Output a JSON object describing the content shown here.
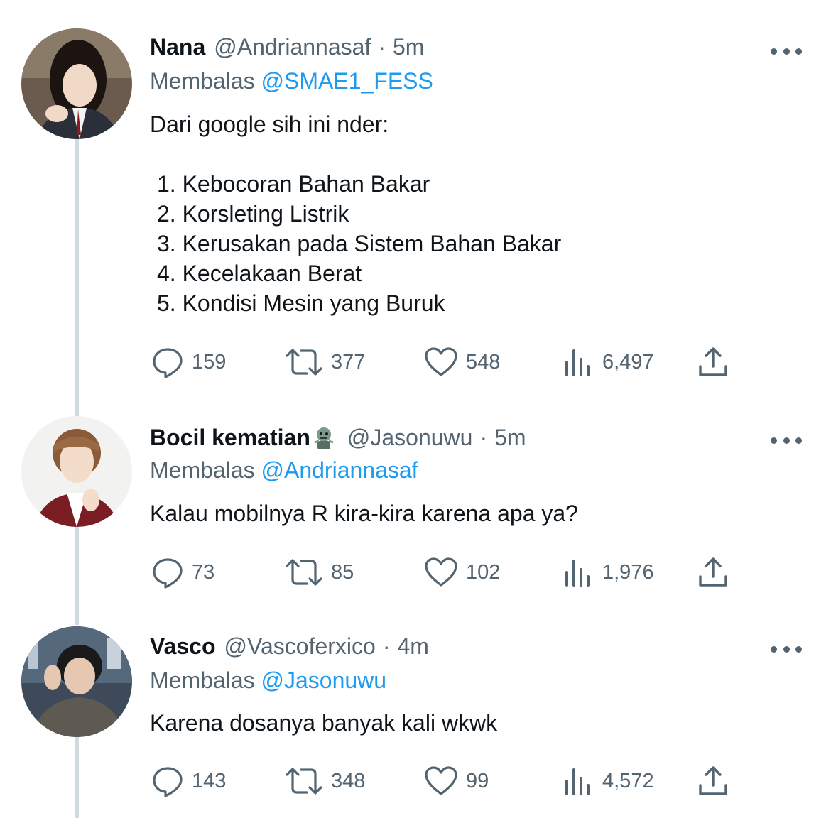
{
  "tweets": [
    {
      "name": "Nana",
      "handle": "@Andriannasaf",
      "separator": "·",
      "time": "5m",
      "reply_prefix": "Membalas",
      "reply_to": "@SMAE1_FESS",
      "text": "Dari google sih ini nder:",
      "list": [
        "1. Kebocoran Bahan Bakar",
        "2. Korsleting Listrik",
        "3. Kerusakan pada Sistem Bahan Bakar",
        "4. Kecelakaan Berat",
        "5. Kondisi Mesin yang Buruk"
      ],
      "replies": "159",
      "retweets": "377",
      "likes": "548",
      "views": "6,497"
    },
    {
      "name": "Bocil kematian",
      "emoji": "zombie-emoji",
      "handle": "@Jasonuwu",
      "separator": "·",
      "time": "5m",
      "reply_prefix": "Membalas",
      "reply_to": "@Andriannasaf",
      "text": "Kalau mobilnya R kira-kira karena apa ya?",
      "replies": "73",
      "retweets": "85",
      "likes": "102",
      "views": "1,976"
    },
    {
      "name": "Vasco",
      "handle": "@Vascoferxico",
      "separator": "·",
      "time": "4m",
      "reply_prefix": "Membalas",
      "reply_to": "@Jasonuwu",
      "text": "Karena dosanya banyak kali wkwk",
      "replies": "143",
      "retweets": "348",
      "likes": "99",
      "views": "4,572"
    }
  ],
  "colors": {
    "text": "#0f1419",
    "secondary": "#536471",
    "mention": "#1d9bf0",
    "thread_line": "#cfd9de"
  },
  "icons": [
    "reply-icon",
    "retweet-icon",
    "like-icon",
    "views-icon",
    "share-icon",
    "more-icon"
  ]
}
